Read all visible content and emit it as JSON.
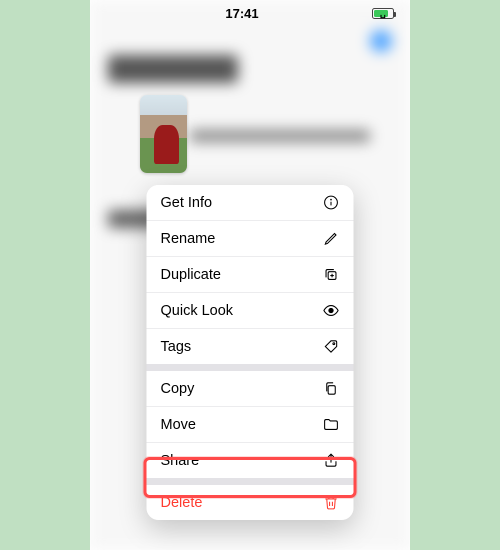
{
  "status": {
    "time": "17:41"
  },
  "menu": {
    "get_info": "Get Info",
    "rename": "Rename",
    "duplicate": "Duplicate",
    "quick_look": "Quick Look",
    "tags": "Tags",
    "copy": "Copy",
    "move": "Move",
    "share": "Share",
    "delete": "Delete"
  }
}
